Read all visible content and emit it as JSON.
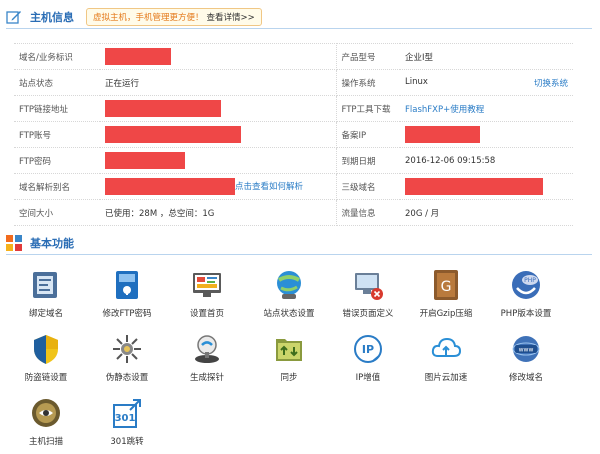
{
  "host_info": {
    "title": "主机信息",
    "promo_text": "虚拟主机，手机管理更方便！",
    "promo_link": "查看详情>>",
    "rows": [
      {
        "l1": "域名/业务标识",
        "v1": "",
        "r1": true,
        "l2": "产品型号",
        "v2": "企业I型"
      },
      {
        "l1": "站点状态",
        "v1": "正在运行",
        "l2": "操作系统",
        "v2": "Linux",
        "action": "切换系统"
      },
      {
        "l1": "FTP链接地址",
        "v1": "",
        "r1": true,
        "l2": "FTP工具下载",
        "v2_link": "FlashFXP+使用教程"
      },
      {
        "l1": "FTP账号",
        "v1": "",
        "r1": true,
        "l2": "备案IP",
        "v2": "",
        "r2": true
      },
      {
        "l1": "FTP密码",
        "v1": "",
        "r1": true,
        "l2": "到期日期",
        "v2": "2016-12-06 09:15:58"
      },
      {
        "l1": "域名解析别名",
        "v1": "",
        "r1": true,
        "v1_link": "点击查看如何解析",
        "l2": "三级域名",
        "v2": "",
        "r2": true
      },
      {
        "l1": "空间大小",
        "v1": "已使用：28M ，总空间：1G",
        "l2": "流量信息",
        "v2": "20G / 月"
      }
    ]
  },
  "basic": {
    "title": "基本功能",
    "items": [
      {
        "label": "绑定域名",
        "icon": "bind-domain-icon"
      },
      {
        "label": "修改FTP密码",
        "icon": "ftp-password-icon"
      },
      {
        "label": "设置首页",
        "icon": "homepage-icon"
      },
      {
        "label": "站点状态设置",
        "icon": "site-status-icon"
      },
      {
        "label": "错误页面定义",
        "icon": "error-page-icon"
      },
      {
        "label": "开启Gzip压缩",
        "icon": "gzip-icon"
      },
      {
        "label": "PHP版本设置",
        "icon": "php-icon"
      },
      {
        "label": "防盗链设置",
        "icon": "anti-leech-icon"
      },
      {
        "label": "伪静态设置",
        "icon": "rewrite-icon"
      },
      {
        "label": "生成探针",
        "icon": "probe-icon"
      },
      {
        "label": "同步",
        "icon": "sync-icon"
      },
      {
        "label": "IP增值",
        "icon": "ip-icon"
      },
      {
        "label": "图片云加速",
        "icon": "cloud-icon"
      },
      {
        "label": "修改域名",
        "icon": "www-icon"
      },
      {
        "label": "主机扫描",
        "icon": "scan-icon"
      },
      {
        "label": "301跳转",
        "icon": "redirect-301-icon",
        "icon_text": "301"
      }
    ]
  }
}
